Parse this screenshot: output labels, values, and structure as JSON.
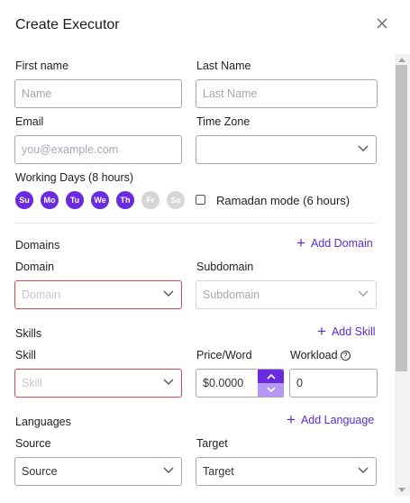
{
  "dialog": {
    "title": "Create Executor",
    "close_icon": "close-icon"
  },
  "form": {
    "first_name": {
      "label": "First name",
      "placeholder": "Name"
    },
    "last_name": {
      "label": "Last Name",
      "placeholder": "Last Name"
    },
    "email": {
      "label": "Email",
      "placeholder": "you@example.com"
    },
    "time_zone": {
      "label": "Time Zone",
      "value": ""
    },
    "working_days": {
      "label": "Working Days (8 hours)",
      "days": [
        {
          "label": "Su",
          "selected": true
        },
        {
          "label": "Mo",
          "selected": true
        },
        {
          "label": "Tu",
          "selected": true
        },
        {
          "label": "We",
          "selected": true
        },
        {
          "label": "Th",
          "selected": true
        },
        {
          "label": "Fr",
          "selected": false
        },
        {
          "label": "Sa",
          "selected": false
        }
      ]
    },
    "ramadan_mode": {
      "label": "Ramadan mode (6 hours)",
      "checked": false
    },
    "domains": {
      "section_title": "Domains",
      "add_label": "Add Domain",
      "domain_label": "Domain",
      "domain_placeholder": "Domain",
      "subdomain_label": "Subdomain",
      "subdomain_placeholder": "Subdomain"
    },
    "skills": {
      "section_title": "Skills",
      "add_label": "Add Skill",
      "skill_label": "Skill",
      "skill_placeholder": "Skill",
      "price_label": "Price/Word",
      "price_value": "$0.0000",
      "workload_label": "Workload",
      "workload_value": "0"
    },
    "languages": {
      "section_title": "Languages",
      "add_label": "Add Language",
      "source_label": "Source",
      "source_value": "Source",
      "target_label": "Target",
      "target_value": "Target"
    }
  },
  "colors": {
    "accent": "#6a2ae0",
    "accent_light": "#b598f3",
    "link": "#5b2bd6",
    "error_border": "#d24a4a",
    "disabled_day": "#d6d6d6"
  }
}
